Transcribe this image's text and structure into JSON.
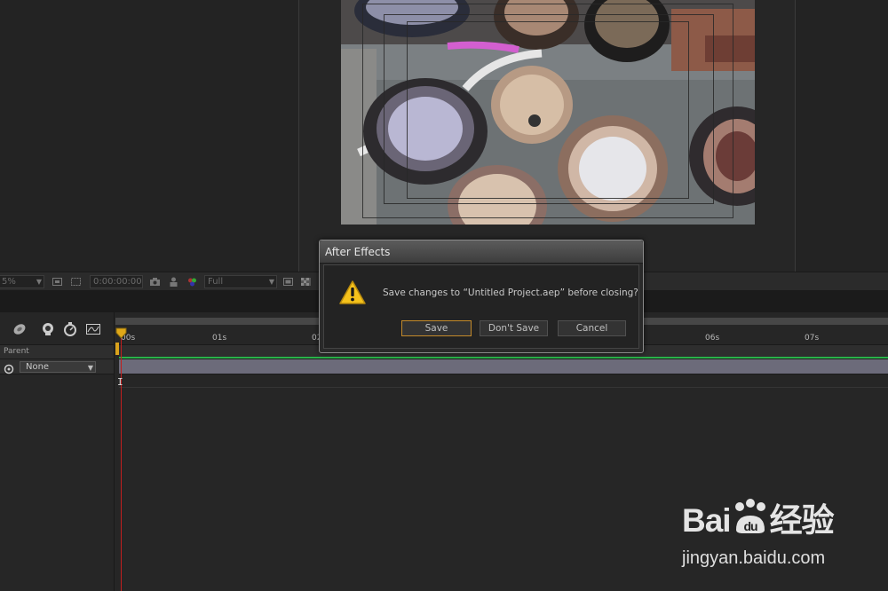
{
  "viewer": {
    "zoom_value": "5%",
    "timecode": "0:00:00:00",
    "resolution": "Full"
  },
  "timeline": {
    "column_header": "Parent",
    "parent_value": "None",
    "ruler_labels": [
      "00s",
      "01s",
      "02s",
      "06s",
      "07s"
    ]
  },
  "dialog": {
    "title": "After Effects",
    "message": "Save changes to “Untitled Project.aep” before closing?",
    "buttons": {
      "save": "Save",
      "dont_save": "Don't Save",
      "cancel": "Cancel"
    }
  },
  "watermark": {
    "logo_left": "Bai",
    "logo_right": "经验",
    "url": "jingyan.baidu.com"
  },
  "colors": {
    "accent": "#c48a2a",
    "playhead": "#c21f1f",
    "work_area_green": "#29b34a",
    "layer_bar": "#6c6b7a"
  },
  "icons": [
    "warning-icon",
    "camera-icon",
    "region-icon",
    "transparency-grid-icon",
    "motion-blur-icon",
    "stopwatch-icon",
    "graph-editor-icon",
    "pickwhip-icon",
    "playhead-icon"
  ]
}
